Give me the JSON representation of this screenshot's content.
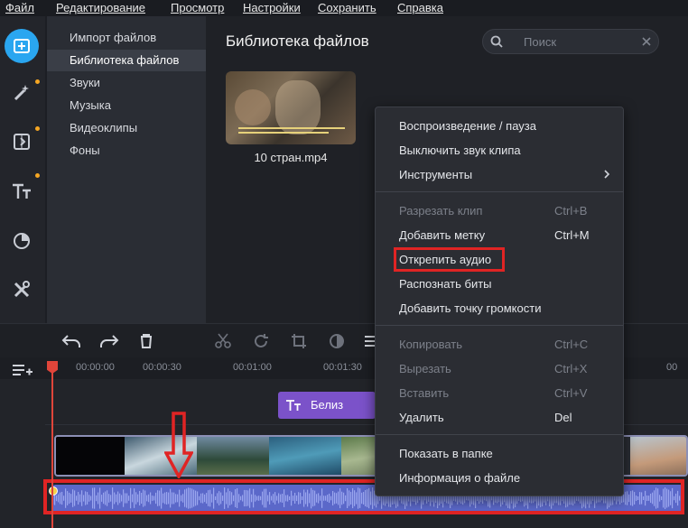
{
  "menubar": {
    "items": [
      "Файл",
      "Редактирование",
      "Просмотр",
      "Настройки",
      "Сохранить",
      "Справка"
    ]
  },
  "left_tools": [
    "import-icon",
    "magic-wand-icon",
    "transition-icon",
    "titles-icon",
    "filter-icon",
    "tools-icon"
  ],
  "library_nav": {
    "items": [
      "Импорт файлов",
      "Библиотека файлов",
      "Звуки",
      "Музыка",
      "Видеоклипы",
      "Фоны"
    ],
    "selected": "Библиотека файлов"
  },
  "main": {
    "title": "Библиотека файлов",
    "search_placeholder": "Поиск",
    "file_name": "10 стран.mp4"
  },
  "ruler": {
    "ticks": [
      "00:00:00",
      "00:00:30",
      "00:01:00",
      "00:01:30",
      "00"
    ]
  },
  "title_clip": {
    "label": "Белиз"
  },
  "context_menu": {
    "groups": [
      [
        {
          "label": "Воспроизведение / пауза",
          "shortcut": "",
          "disabled": false
        },
        {
          "label": "Выключить звук клипа",
          "shortcut": "",
          "disabled": false
        },
        {
          "label": "Инструменты",
          "shortcut": "",
          "disabled": false,
          "submenu": true
        }
      ],
      [
        {
          "label": "Разрезать клип",
          "shortcut": "Ctrl+B",
          "disabled": true
        },
        {
          "label": "Добавить метку",
          "shortcut": "Ctrl+M",
          "disabled": false
        },
        {
          "label": "Открепить аудио",
          "shortcut": "",
          "disabled": false,
          "highlighted": true
        },
        {
          "label": "Распознать биты",
          "shortcut": "",
          "disabled": false
        },
        {
          "label": "Добавить точку громкости",
          "shortcut": "",
          "disabled": false
        }
      ],
      [
        {
          "label": "Копировать",
          "shortcut": "Ctrl+C",
          "disabled": true
        },
        {
          "label": "Вырезать",
          "shortcut": "Ctrl+X",
          "disabled": true
        },
        {
          "label": "Вставить",
          "shortcut": "Ctrl+V",
          "disabled": true
        },
        {
          "label": "Удалить",
          "shortcut": "Del",
          "disabled": false
        }
      ],
      [
        {
          "label": "Показать в папке",
          "shortcut": "",
          "disabled": false
        },
        {
          "label": "Информация о файле",
          "shortcut": "",
          "disabled": false
        }
      ]
    ]
  },
  "colors": {
    "accent": "#2aa6f0",
    "highlight_red": "#e02424",
    "title_clip": "#7b52c9",
    "audio_clip": "#5b68c9",
    "notification_dot": "#f5a623"
  }
}
